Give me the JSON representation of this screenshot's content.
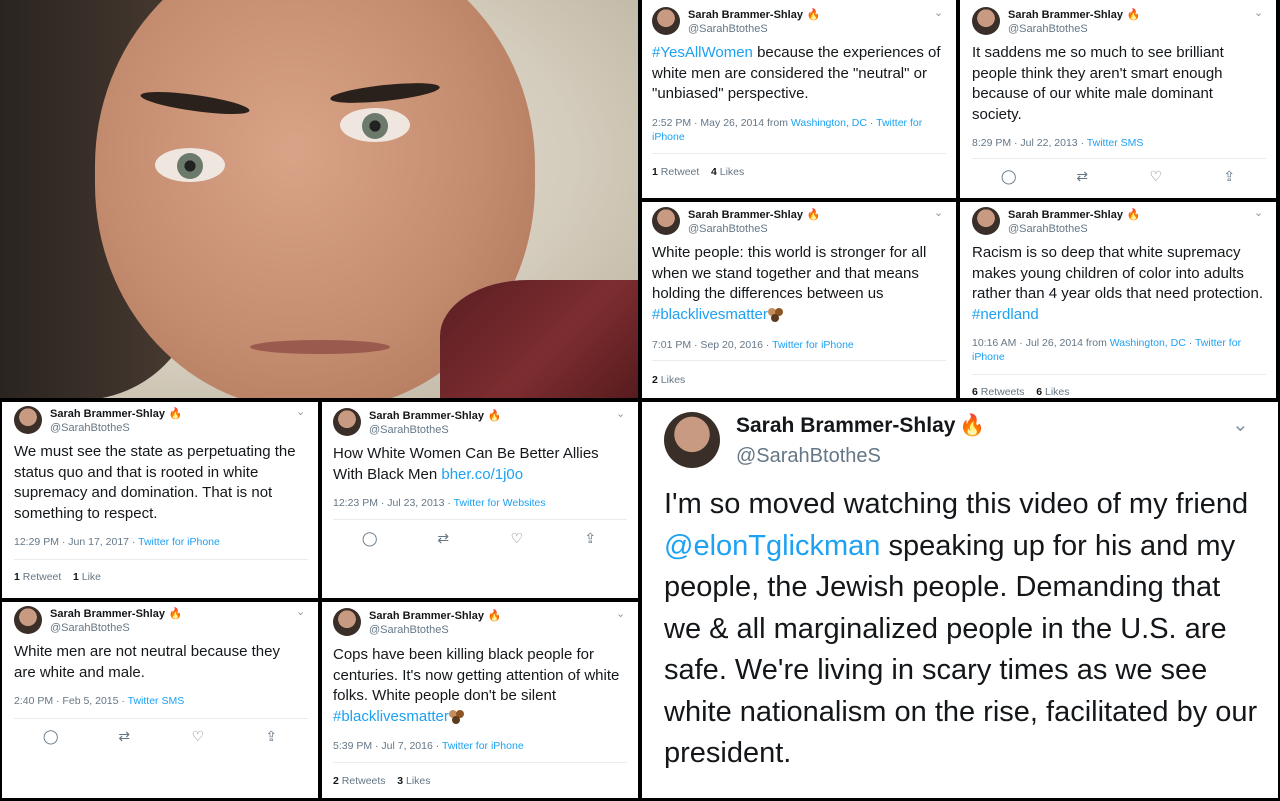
{
  "user": {
    "name": "Sarah Brammer-Shlay",
    "handle": "@SarahBtotheS"
  },
  "icons": {
    "fire": "fire-emoji",
    "chevron": "chevron-down-icon",
    "reply": "reply-icon",
    "retweet": "retweet-icon",
    "like": "heart-icon",
    "share": "share-icon"
  },
  "colors": {
    "link": "#1da1f2",
    "muted": "#657786",
    "text": "#14171a"
  },
  "tweets": {
    "t1": {
      "tag": "#YesAllWomen",
      "text": " because the experiences of white men are considered the \"neutral\" or \"unbiased\" perspective.",
      "time": "2:52 PM · May 26, 2014 from ",
      "place": "Washington, DC",
      "sep": " · ",
      "via": "Twitter for iPhone",
      "retweets": "1",
      "retweets_label": "Retweet",
      "likes": "4",
      "likes_label": "Likes"
    },
    "t2": {
      "text": "It saddens me so much to see brilliant people think they aren't smart enough because of our white male dominant society.",
      "time": "8:29 PM · Jul 22, 2013 · ",
      "via": "Twitter SMS"
    },
    "t3": {
      "text": "White people: this world is stronger for all when we stand together and that means holding  the differences between us ",
      "tag": "#blacklivesmatter",
      "time": "7:01 PM · Sep 20, 2016 · ",
      "via": "Twitter for iPhone",
      "likes": "2",
      "likes_label": "Likes"
    },
    "t4": {
      "text": "Racism is so deep that white supremacy makes young children of color into adults rather than 4 year olds that need protection. ",
      "tag": "#nerdland",
      "time": "10:16 AM · Jul 26, 2014 from ",
      "place": "Washington, DC",
      "sep": " · ",
      "via": "Twitter for iPhone",
      "retweets": "6",
      "retweets_label": "Retweets",
      "likes": "6",
      "likes_label": "Likes"
    },
    "t5": {
      "text": "We must see the state as perpetuating the status quo and that is rooted in white supremacy and domination. That is not something to respect.",
      "time": "12:29 PM · Jun 17, 2017 · ",
      "via": "Twitter for iPhone",
      "retweets": "1",
      "retweets_label": "Retweet",
      "likes": "1",
      "likes_label": "Like"
    },
    "t6": {
      "text": "How White Women Can Be Better Allies With Black Men ",
      "link": "bher.co/1j0o",
      "time": "12:23 PM · Jul 23, 2013 · ",
      "via": "Twitter for Websites"
    },
    "t7": {
      "text": "White men are not neutral because they are white and male.",
      "time": "2:40 PM · Feb 5, 2015 · ",
      "via": "Twitter SMS"
    },
    "t8": {
      "text": "Cops have been killing black people for centuries. It's now getting attention of white folks. White people don't be silent ",
      "tag": "#blacklivesmatter",
      "time": "5:39 PM · Jul 7, 2016 · ",
      "via": "Twitter for iPhone",
      "retweets": "2",
      "retweets_label": "Retweets",
      "likes": "3",
      "likes_label": "Likes"
    },
    "big": {
      "text1": "I'm so moved watching this video of my friend ",
      "mention": "@elonTglickman",
      "text2": " speaking up for his and my people, the Jewish people. Demanding that we & all marginalized people in the U.S. are safe. We're living in scary times as we see white nationalism on the rise, facilitated by our president."
    }
  }
}
